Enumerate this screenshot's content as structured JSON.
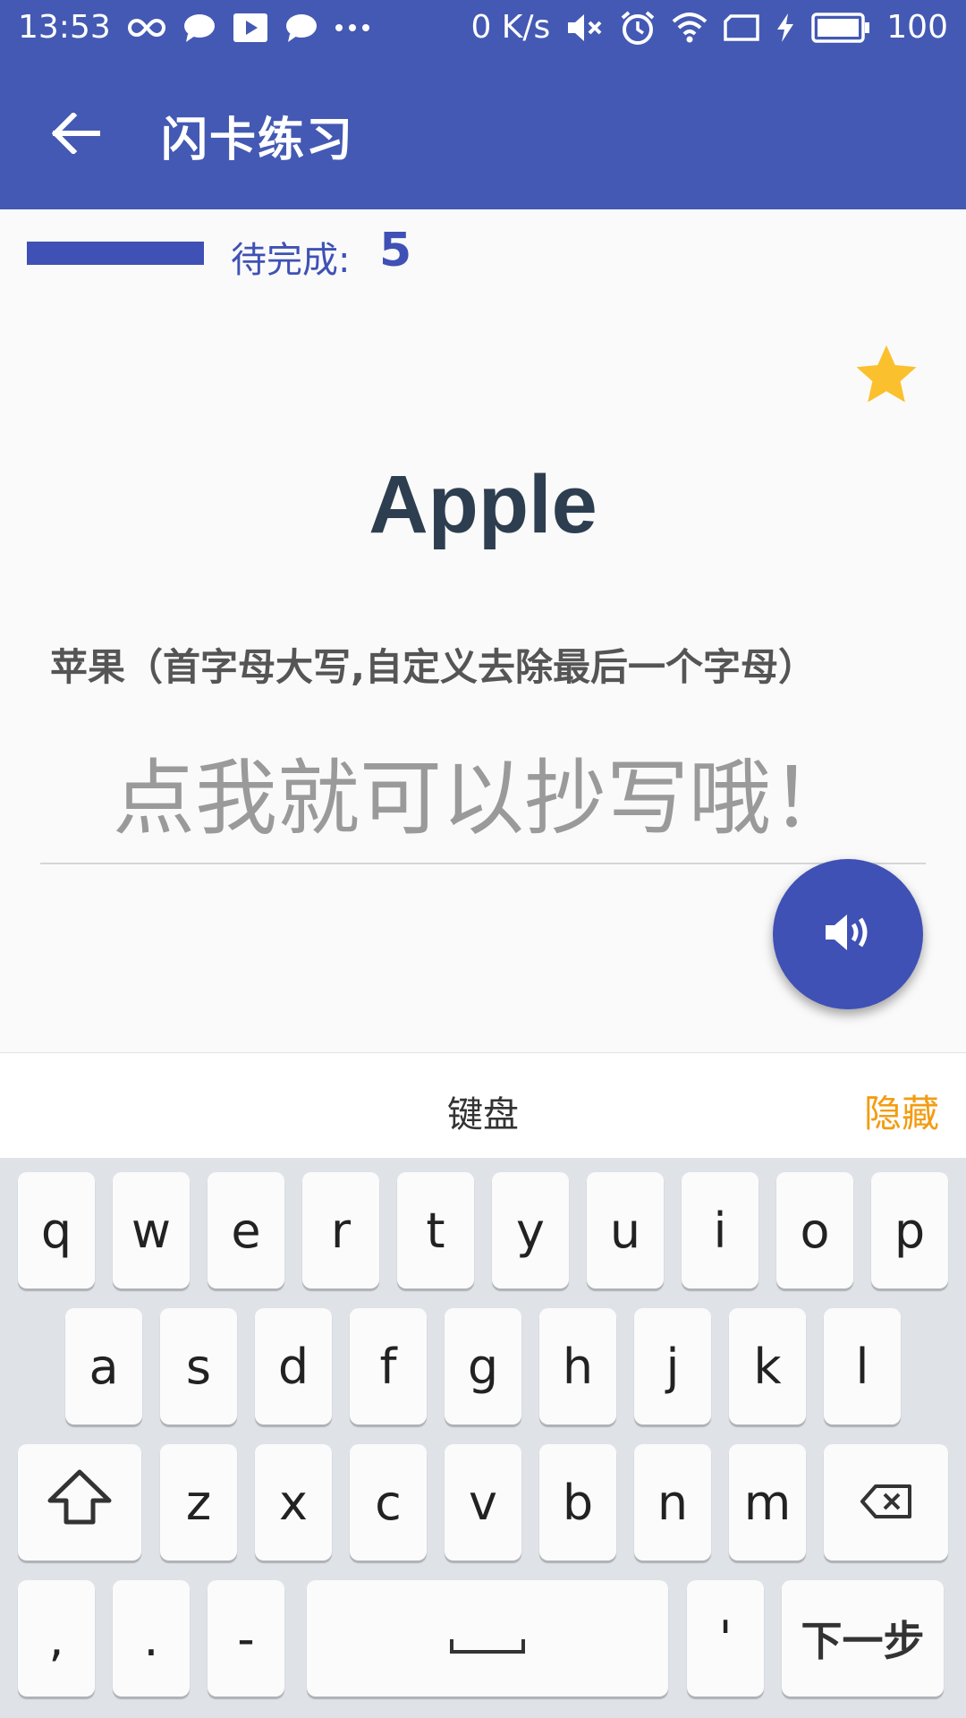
{
  "status_bar": {
    "time": "13:53",
    "net_speed": "0 K/s",
    "battery": "100",
    "icons": [
      "infinity-icon",
      "chat-icon",
      "play-icon",
      "chat-icon",
      "more-dots-icon",
      "mute-icon",
      "alarm-icon",
      "wifi-icon",
      "sim-icon",
      "charging-icon",
      "battery-icon"
    ]
  },
  "app_bar": {
    "title": "闪卡练习",
    "back_icon": "arrow-left-icon"
  },
  "progress": {
    "label": "待完成:",
    "count": "5"
  },
  "card": {
    "word": "Apple",
    "definition": "苹果（首字母大写,自定义去除最后一个字母）",
    "input_placeholder": "点我就可以抄写哦！",
    "input_value": "",
    "favorite_icon": "star-icon",
    "speak_icon": "speaker-icon"
  },
  "keyboard": {
    "title": "键盘",
    "hide_label": "隐藏",
    "row1": [
      "q",
      "w",
      "e",
      "r",
      "t",
      "y",
      "u",
      "i",
      "o",
      "p"
    ],
    "row2": [
      "a",
      "s",
      "d",
      "f",
      "g",
      "h",
      "j",
      "k",
      "l"
    ],
    "row3": [
      "z",
      "x",
      "c",
      "v",
      "b",
      "n",
      "m"
    ],
    "comma": ",",
    "period": ".",
    "dash": "-",
    "apostrophe": "'",
    "next_label": "下一步"
  },
  "colors": {
    "primary": "#3f51b5",
    "header": "#4459b3",
    "star": "#fbc02d",
    "accent": "#f39c12",
    "word": "#2d3e50"
  }
}
